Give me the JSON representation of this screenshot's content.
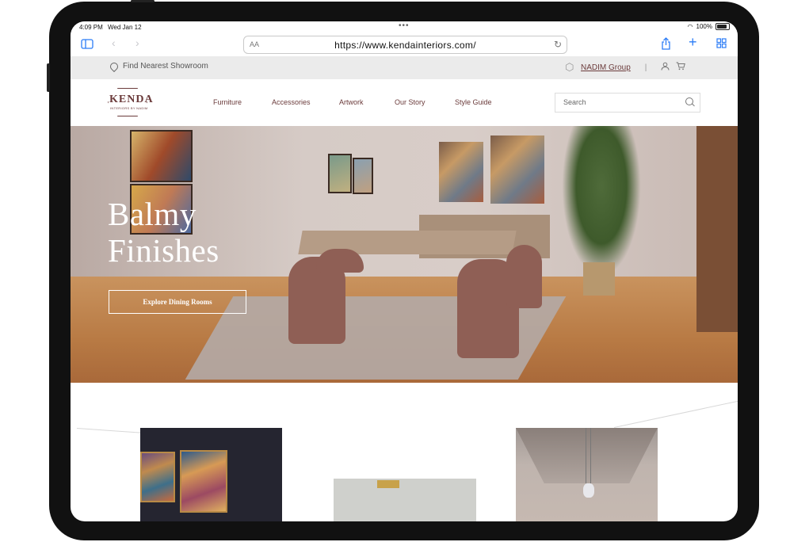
{
  "status_bar": {
    "time": "4:09 PM",
    "date": "Wed Jan 12",
    "battery": "100%"
  },
  "browser": {
    "url": "https://www.kendainteriors.com/",
    "text_size_label": "AA"
  },
  "utility_bar": {
    "showroom_label": "Find Nearest Showroom",
    "group_label": "NADIM Group"
  },
  "brand": {
    "name": "KENDA",
    "tagline": "INTERIORS BY NADIM",
    "color": "#6b3b3b"
  },
  "nav": {
    "items": [
      "Furniture",
      "Accessories",
      "Artwork",
      "Our Story",
      "Style Guide"
    ],
    "search_placeholder": "Search"
  },
  "hero": {
    "title_line1": "Balmy",
    "title_line2": "Finishes",
    "cta_label": "Explore Dining Rooms"
  },
  "icons": {
    "sidebar": "sidebar-icon",
    "back": "chevron-left-icon",
    "forward": "chevron-right-icon",
    "share": "share-icon",
    "new_tab": "plus-icon",
    "tabs": "tabs-grid-icon",
    "reload": "reload-icon",
    "location": "map-pin-icon",
    "account": "user-icon",
    "cart": "cart-icon",
    "search": "search-icon"
  },
  "colors": {
    "accent_blue": "#2b7cf6",
    "utility_bg": "#ebebeb"
  }
}
